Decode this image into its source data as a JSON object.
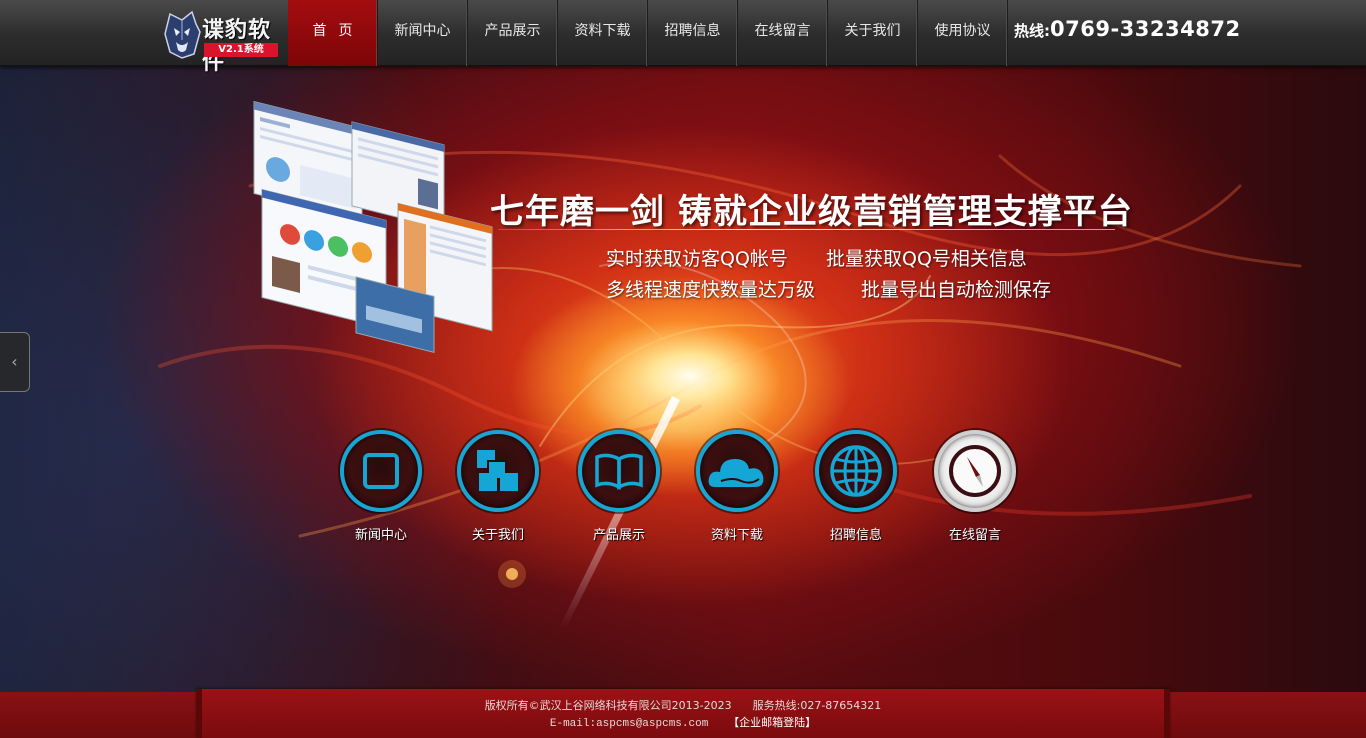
{
  "header": {
    "logo_name": "谍豹软件",
    "logo_version": "V2.1系统",
    "nav": [
      {
        "label": "首页"
      },
      {
        "label": "新闻中心"
      },
      {
        "label": "产品展示"
      },
      {
        "label": "资料下载"
      },
      {
        "label": "招聘信息"
      },
      {
        "label": "在线留言"
      },
      {
        "label": "关于我们"
      },
      {
        "label": "使用协议"
      }
    ],
    "hotline_label": "热线:",
    "hotline_number": "0769-33234872"
  },
  "hero": {
    "headline": "七年磨一剑  铸就企业级营销管理支撑平台",
    "features": [
      "实时获取访客QQ帐号",
      "批量获取QQ号相关信息",
      "多线程速度快数量达万级",
      "批量导出自动检测保存"
    ],
    "prev_arrow": "‹"
  },
  "quick_links": [
    {
      "label": "新闻中心",
      "icon": "square-icon"
    },
    {
      "label": "关于我们",
      "icon": "blocks-icon"
    },
    {
      "label": "产品展示",
      "icon": "book-icon"
    },
    {
      "label": "资料下载",
      "icon": "cloud-icon"
    },
    {
      "label": "招聘信息",
      "icon": "globe-icon"
    },
    {
      "label": "在线留言",
      "icon": "compass-icon"
    }
  ],
  "footer": {
    "copyright": "版权所有©武汉上谷网络科技有限公司2013-2023",
    "service_hotline": "服务热线:027-87654321",
    "email": "E-mail:aspcms@aspcms.com",
    "mail_login": "【企业邮箱登陆】"
  },
  "colors": {
    "accent_red": "#a40d10",
    "icon_blue": "#15a6d6"
  }
}
